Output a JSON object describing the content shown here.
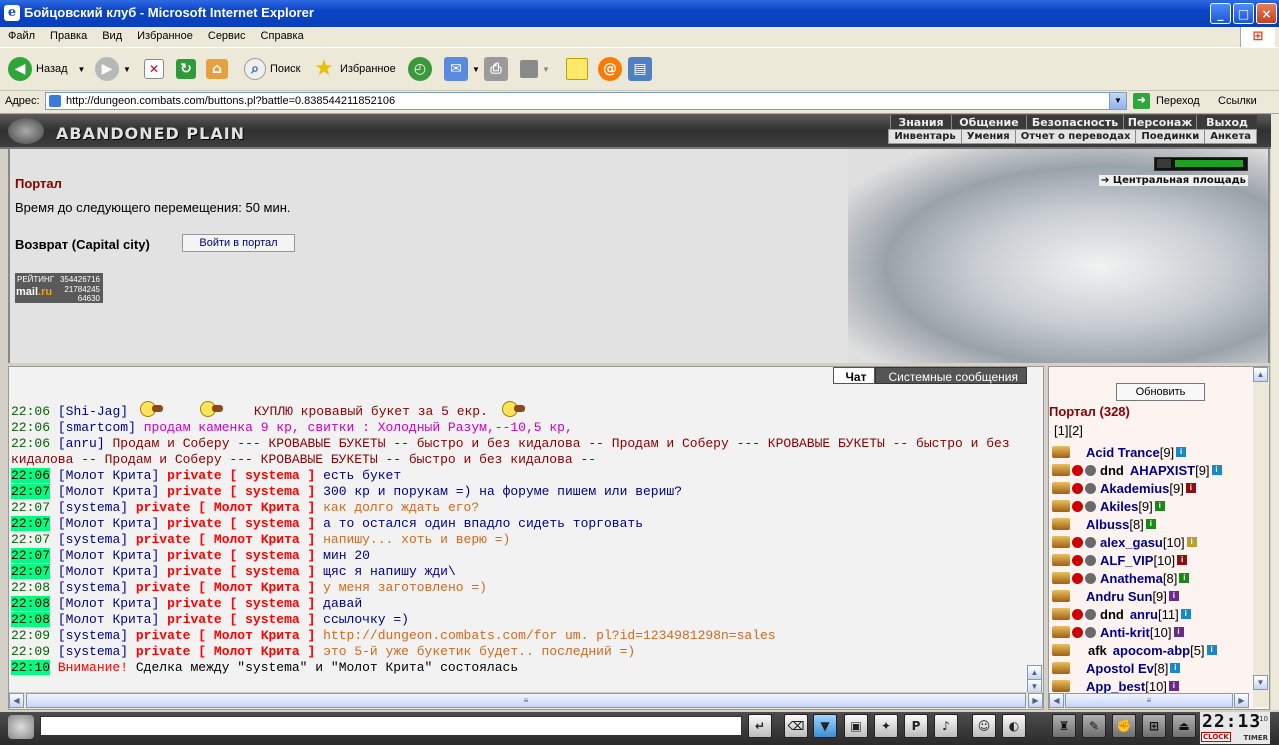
{
  "window": {
    "title": "Бойцовский клуб - Microsoft Internet Explorer"
  },
  "menu": [
    "Файл",
    "Правка",
    "Вид",
    "Избранное",
    "Сервис",
    "Справка"
  ],
  "toolbar": {
    "back": "Назад",
    "search": "Поиск",
    "favorites": "Избранное"
  },
  "address": {
    "label": "Адрес:",
    "url": "http://dungeon.combats.com/buttons.pl?battle=0.838544211852106",
    "go": "Переход",
    "links": "Ссылки"
  },
  "banner": {
    "brand": "ABANDONED PLAIN",
    "top_nav": [
      "Знания",
      "Общение",
      "Безопасность",
      "Персонаж",
      "Выход"
    ],
    "sub_nav": [
      "Инвентарь",
      "Умения",
      "Отчет о переводах",
      "Поединки",
      "Анкета"
    ]
  },
  "main": {
    "title": "Портал",
    "timer": "Время до следующего перемещения:  50 мин.",
    "return_label": "Возврат (Capital city)",
    "portal_button": "Войти в портал",
    "location": "Центральная площадь",
    "counter": {
      "label": "РЕЙТИНГ",
      "brand_a": "mail",
      "brand_b": ".ru",
      "n1": "354426716",
      "n2": "21784245",
      "n3": "64630"
    }
  },
  "chat": {
    "tabs": [
      "Чат",
      "Системные сообщения"
    ],
    "lines": [
      {
        "time": "22:06",
        "hl": false,
        "nick": "Shi-Jag",
        "text": "КУПЛЮ кровавый букет за 5 екр.",
        "color": "#8b0000",
        "smiles": true
      },
      {
        "time": "22:06",
        "hl": false,
        "nick": "smartcom",
        "text": "продам каменка 9 кр, свитки : Холодный Разум,--10,5 кр,",
        "color": "#cc00cc"
      },
      {
        "time": "22:06",
        "hl": false,
        "nick": "anru",
        "text": "Продам и Соберу --- КРОВАВЫЕ БУКЕТЫ -- быстро и без кидалова -- Продам и Соберу --- КРОВАВЫЕ БУКЕТЫ -- быстро и без кидалова -- Продам и Соберу --- КРОВАВЫЕ БУКЕТЫ -- быстро и без кидалова --",
        "color": "#8b0000",
        "wrap": true
      },
      {
        "time": "22:06",
        "hl": true,
        "nick": "Молот Крита",
        "priv": "private [ systema ]",
        "text": "есть букет",
        "color": "#00008b"
      },
      {
        "time": "22:07",
        "hl": true,
        "nick": "Молот Крита",
        "priv": "private [ systema ]",
        "text": "300 кр и порукам =) на форуме пишем или вериш?",
        "color": "#00008b"
      },
      {
        "time": "22:07",
        "hl": false,
        "nick": "systema",
        "priv": "private [ Молот Крита ]",
        "text": "как долго ждать его?",
        "color": "#d2691e"
      },
      {
        "time": "22:07",
        "hl": true,
        "nick": "Молот Крита",
        "priv": "private [ systema ]",
        "text": "а то остался один впадло сидеть торговать",
        "color": "#00008b"
      },
      {
        "time": "22:07",
        "hl": false,
        "nick": "systema",
        "priv": "private [ Молот Крита ]",
        "text": "напишу... хоть и верю =)",
        "color": "#d2691e"
      },
      {
        "time": "22:07",
        "hl": true,
        "nick": "Молот Крита",
        "priv": "private [ systema ]",
        "text": "мин 20",
        "color": "#00008b"
      },
      {
        "time": "22:07",
        "hl": true,
        "nick": "Молот Крита",
        "priv": "private [ systema ]",
        "text": "щяс я напишу жди\\",
        "color": "#00008b"
      },
      {
        "time": "22:08",
        "hl": false,
        "nick": "systema",
        "priv": "private [ Молот Крита ]",
        "text": "у меня заготовлено =)",
        "color": "#d2691e"
      },
      {
        "time": "22:08",
        "hl": true,
        "nick": "Молот Крита",
        "priv": "private [ systema ]",
        "text": "давай",
        "color": "#00008b"
      },
      {
        "time": "22:08",
        "hl": true,
        "nick": "Молот Крита",
        "priv": "private [ systema ]",
        "text": "ссылочку =)",
        "color": "#00008b"
      },
      {
        "time": "22:09",
        "hl": false,
        "nick": "systema",
        "priv": "private [ Молот Крита ]",
        "text": "http://dungeon.combats.com/for um. pl?id=1234981298n=sales",
        "color": "#d2691e"
      },
      {
        "time": "22:09",
        "hl": false,
        "nick": "systema",
        "priv": "private [ Молот Крита ]",
        "text": "это 5-й уже букетик будет.. последний =)",
        "color": "#d2691e"
      },
      {
        "time": "22:10",
        "hl": true,
        "system": "Внимание!",
        "text": "Сделка между \"systema\" и \"Молот Крита\" состоялась",
        "color": "#000000"
      }
    ]
  },
  "users": {
    "refresh": "Обновить",
    "title": "Портал (328)",
    "pages": "[1][2]",
    "list": [
      {
        "pre": "",
        "name": "Acid Trance",
        "lvl": "[9]",
        "inf": "b",
        "marks": 0
      },
      {
        "pre": "dnd",
        "name": "АНАРХIST",
        "lvl": "[9]",
        "inf": "b",
        "marks": 2
      },
      {
        "pre": "",
        "name": "Akademius",
        "lvl": "[9]",
        "inf": "r",
        "marks": 2
      },
      {
        "pre": "",
        "name": "Akiles",
        "lvl": "[9]",
        "inf": "g",
        "marks": 2
      },
      {
        "pre": "",
        "name": "Albuss",
        "lvl": "[8]",
        "inf": "g",
        "marks": 0
      },
      {
        "pre": "",
        "name": "alex_gasu",
        "lvl": "[10]",
        "inf": "y",
        "marks": 2
      },
      {
        "pre": "",
        "name": "ALF_VIP",
        "lvl": "[10]",
        "inf": "r",
        "marks": 2
      },
      {
        "pre": "",
        "name": "Anathema",
        "lvl": "[8]",
        "inf": "g",
        "marks": 2
      },
      {
        "pre": "",
        "name": "Andru Sun",
        "lvl": "[9]",
        "inf": "p",
        "marks": 0
      },
      {
        "pre": "dnd",
        "name": "anru",
        "lvl": "[11]",
        "inf": "b",
        "marks": 2
      },
      {
        "pre": "",
        "name": "Anti-krit",
        "lvl": "[10]",
        "inf": "p",
        "marks": 2
      },
      {
        "pre": "afk",
        "name": "apocom-abp",
        "lvl": "[5]",
        "inf": "b",
        "marks": 0
      },
      {
        "pre": "",
        "name": "Apostol Ev",
        "lvl": "[8]",
        "inf": "b",
        "marks": 0
      },
      {
        "pre": "",
        "name": "App_best",
        "lvl": "[10]",
        "inf": "p",
        "marks": 0
      }
    ]
  },
  "clock": {
    "time": "22:13",
    "sec": "10",
    "label1": "CLOCK",
    "label2": "TIMER"
  },
  "colors": {
    "title_bar": "#0a44c7",
    "portal_red": "#8b0000",
    "nick_blue": "#00008b",
    "private_red": "#ff0000",
    "time_green": "#006400",
    "highlight": "#00ff7f"
  }
}
